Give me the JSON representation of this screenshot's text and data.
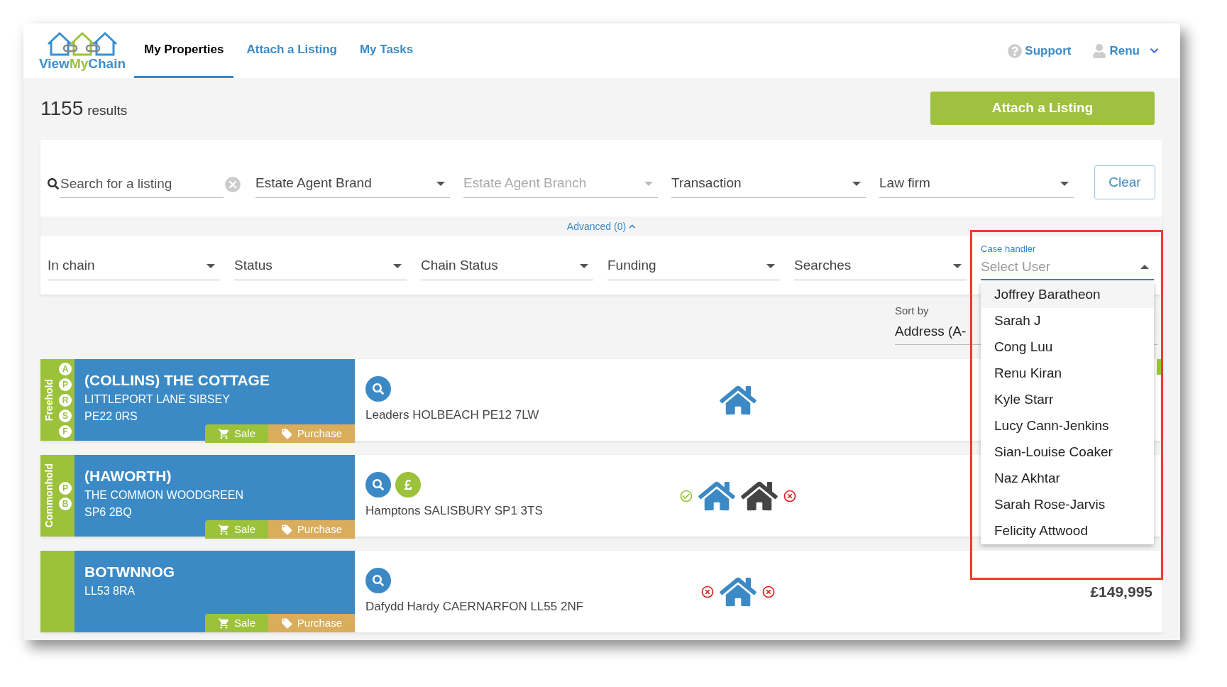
{
  "nav": {
    "logo_text": [
      "View",
      "My",
      "Chain"
    ],
    "tabs": [
      {
        "label": "My Properties",
        "selected": true
      },
      {
        "label": "Attach a Listing",
        "selected": false
      },
      {
        "label": "My Tasks",
        "selected": false
      }
    ],
    "support": "Support",
    "user": "Renu"
  },
  "results": {
    "count": "1155",
    "label": "results"
  },
  "attach_button": "Attach a Listing",
  "filters": {
    "search_placeholder": "Search for a listing",
    "row1": [
      {
        "label": "Estate Agent Brand",
        "disabled": false
      },
      {
        "label": "Estate Agent Branch",
        "disabled": true
      },
      {
        "label": "Transaction",
        "disabled": false
      },
      {
        "label": "Law firm",
        "disabled": false
      }
    ],
    "clear": "Clear",
    "advanced": "Advanced (0)",
    "advanced_expanded": true,
    "row2": [
      {
        "label": "In chain"
      },
      {
        "label": "Status"
      },
      {
        "label": "Chain Status"
      },
      {
        "label": "Funding"
      },
      {
        "label": "Searches"
      }
    ],
    "case_handler": {
      "label": "Case handler",
      "placeholder": "Select User",
      "expanded": true,
      "options": [
        {
          "name": "Joffrey Baratheon",
          "highlighted": true
        },
        {
          "name": "Sarah J",
          "highlighted": false
        },
        {
          "name": "Cong Luu",
          "highlighted": false
        },
        {
          "name": "Renu Kiran",
          "highlighted": false
        },
        {
          "name": "Kyle Starr",
          "highlighted": false
        },
        {
          "name": "Lucy Cann-Jenkins",
          "highlighted": false
        },
        {
          "name": "Sian-Louise Coaker",
          "highlighted": false
        },
        {
          "name": "Naz Akhtar",
          "highlighted": false
        },
        {
          "name": "Sarah Rose-Jarvis",
          "highlighted": false
        },
        {
          "name": "Felicity Attwood",
          "highlighted": false
        }
      ]
    }
  },
  "sort": {
    "label": "Sort by",
    "value": "Address (A-"
  },
  "listings": [
    {
      "tenure": "Freehold",
      "badges": [
        "A",
        "P",
        "R",
        "S",
        "F"
      ],
      "title": "(COLLINS) THE COTTAGE",
      "lines": [
        "LITTLEPORT LANE SIBSEY",
        "PE22 0RS"
      ],
      "tags": [
        {
          "kind": "sale",
          "label": "Sale"
        },
        {
          "kind": "purchase",
          "label": "Purchase"
        }
      ],
      "icons": [
        {
          "kind": "search"
        }
      ],
      "agent": "Leaders HOLBEACH PE12 7LW",
      "chain": [
        {
          "kind": "house"
        }
      ],
      "status_strip": true
    },
    {
      "tenure": "Commonhold",
      "badges": [
        "P",
        "B"
      ],
      "title": "(HAWORTH)",
      "lines": [
        "THE COMMON WOODGREEN",
        "SP6 2BQ"
      ],
      "tags": [
        {
          "kind": "sale",
          "label": "Sale"
        },
        {
          "kind": "purchase",
          "label": "Purchase"
        }
      ],
      "icons": [
        {
          "kind": "search"
        },
        {
          "kind": "funding"
        }
      ],
      "agent": "Hamptons SALISBURY SP1 3TS",
      "chain": [
        {
          "kind": "check"
        },
        {
          "kind": "house"
        },
        {
          "kind": "house-dark"
        },
        {
          "kind": "cross"
        }
      ],
      "status_strip": false
    },
    {
      "title": "BOTWNNOG",
      "lines": [
        "LL53 8RA"
      ],
      "tags": [
        {
          "kind": "sale",
          "label": "Sale"
        },
        {
          "kind": "purchase",
          "label": "Purchase"
        }
      ],
      "icons": [
        {
          "kind": "search"
        }
      ],
      "agent": "Dafydd Hardy CAERNARFON LL55 2NF",
      "chain": [
        {
          "kind": "cross"
        },
        {
          "kind": "house"
        },
        {
          "kind": "cross"
        }
      ],
      "price": "£149,995",
      "status_strip": false
    }
  ]
}
